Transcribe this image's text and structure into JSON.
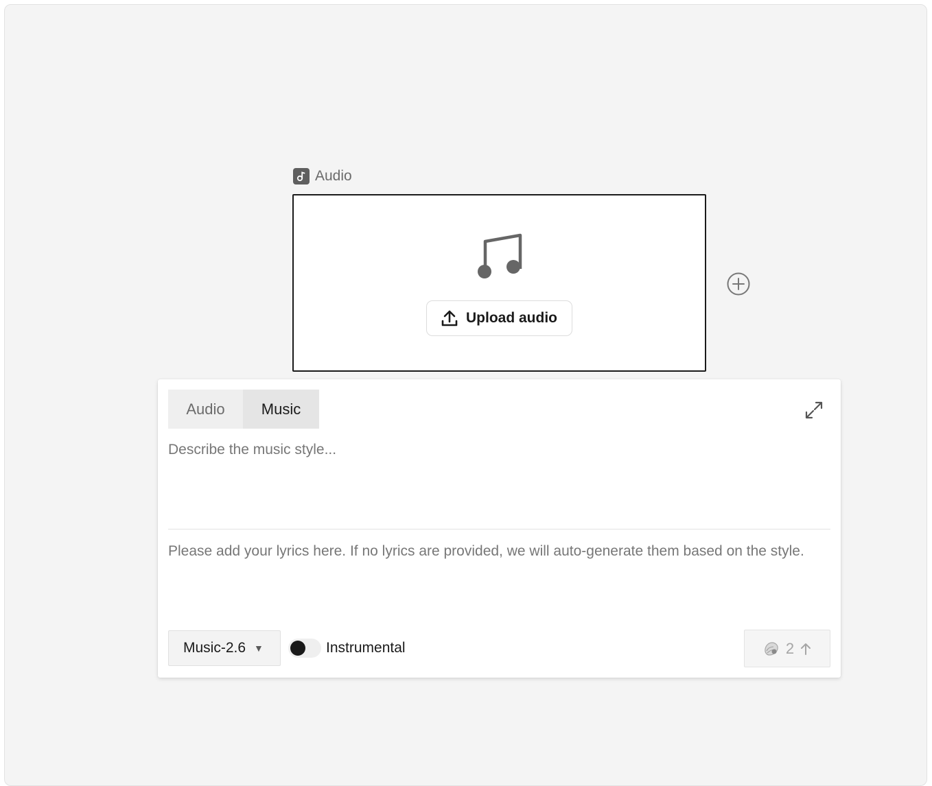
{
  "node": {
    "label": "Audio",
    "upload_label": "Upload audio"
  },
  "panel": {
    "tabs": [
      {
        "label": "Audio",
        "active": false
      },
      {
        "label": "Music",
        "active": true
      }
    ],
    "style_placeholder": "Describe the music style...",
    "lyrics_placeholder": "Please add your lyrics here. If no lyrics are provided, we will auto-generate them based on the style.",
    "model": "Music-2.6",
    "instrumental_label": "Instrumental",
    "instrumental_on": false,
    "credits": "2"
  },
  "icons": {
    "node_badge": "music-note-icon",
    "note": "music-notes-icon",
    "upload": "upload-icon",
    "add": "plus-circle-icon",
    "expand": "expand-icon",
    "credits": "shell-icon",
    "submit": "arrow-up-icon"
  }
}
